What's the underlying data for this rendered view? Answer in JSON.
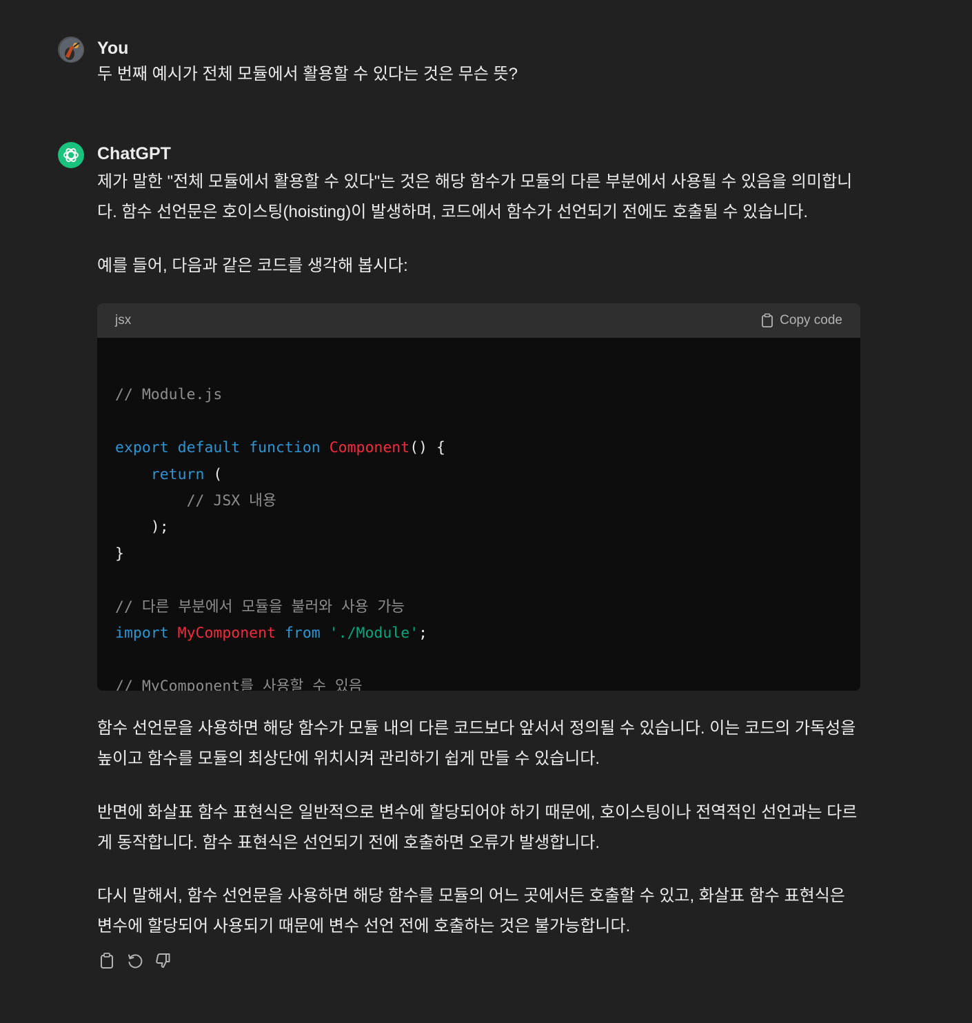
{
  "user_message": {
    "author": "You",
    "text": "두 번째 예시가 전체 모듈에서 활용할 수 있다는 것은 무슨 뜻?"
  },
  "assistant_message": {
    "author": "ChatGPT",
    "paragraphs": [
      "제가 말한 \"전체 모듈에서 활용할 수 있다\"는 것은 해당 함수가 모듈의 다른 부분에서 사용될 수 있음을 의미합니다. 함수 선언문은 호이스팅(hoisting)이 발생하며, 코드에서 함수가 선언되기 전에도 호출될 수 있습니다.",
      "예를 들어, 다음과 같은 코드를 생각해 봅시다:",
      "함수 선언문을 사용하면 해당 함수가 모듈 내의 다른 코드보다 앞서서 정의될 수 있습니다. 이는 코드의 가독성을 높이고 함수를 모듈의 최상단에 위치시켜 관리하기 쉽게 만들 수 있습니다.",
      "반면에 화살표 함수 표현식은 일반적으로 변수에 할당되어야 하기 때문에, 호이스팅이나 전역적인 선언과는 다르게 동작합니다. 함수 표현식은 선언되기 전에 호출하면 오류가 발생합니다.",
      "다시 말해서, 함수 선언문을 사용하면 해당 함수를 모듈의 어느 곳에서든 호출할 수 있고, 화살표 함수 표현식은 변수에 할당되어 사용되기 때문에 변수 선언 전에 호출하는 것은 불가능합니다."
    ],
    "code_block": {
      "language": "jsx",
      "copy_label": "Copy code",
      "tokens": {
        "l1_comment": "// Module.js",
        "l3_export": "export",
        "l3_default": "default",
        "l3_function": "function",
        "l3_name": "Component",
        "l3_rest": "() {",
        "l4_return": "return",
        "l4_rest": "(",
        "l5_comment": "// JSX 내용",
        "l6_rest": ");",
        "l7_rest": "}",
        "l9_comment": "// 다른 부분에서 모듈을 불러와 사용 가능",
        "l10_import": "import",
        "l10_name": "MyComponent",
        "l10_from": "from",
        "l10_path": "'./Module'",
        "l10_semi": ";",
        "l12_comment": "// MyComponent를 사용할 수 있음"
      }
    },
    "actions": [
      "copy-icon",
      "regenerate-icon",
      "thumbs-down-icon"
    ]
  },
  "colors": {
    "background": "#212121",
    "code_background": "#0d0d0d",
    "code_header": "#2f2f2f",
    "keyword": "#2e95d3",
    "function_name": "#f22c3d",
    "string": "#00a67d",
    "comment": "#8e8e8e",
    "gpt_avatar": "#19c37d"
  }
}
